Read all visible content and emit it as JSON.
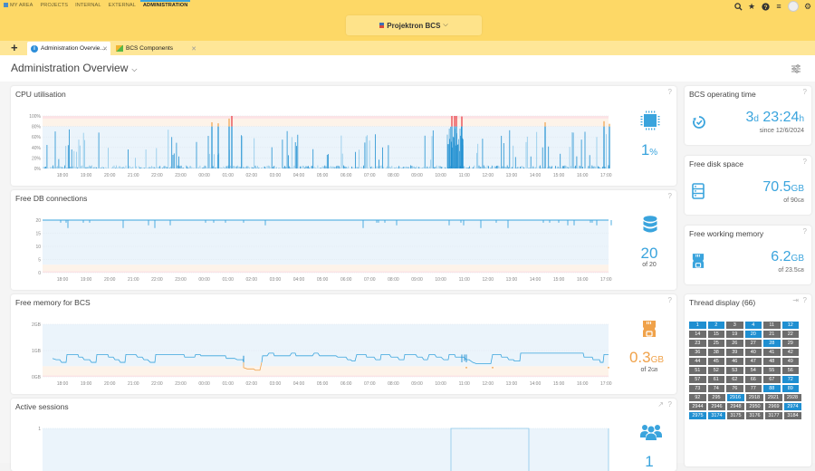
{
  "topnav": {
    "items": [
      "MY AREA",
      "PROJECTS",
      "INTERNAL",
      "EXTERNAL",
      "ADMINISTRATION"
    ],
    "active": "ADMINISTRATION",
    "icons": [
      "search-icon",
      "star-icon",
      "help-icon",
      "menu-icon",
      "avatar",
      "gear-icon"
    ]
  },
  "project_selector": {
    "label": "Projektron BCS"
  },
  "tabs": [
    {
      "label": "Administration Overvie…",
      "icon": "info-icon",
      "active": true
    },
    {
      "label": "BCS Components",
      "icon": "components-icon",
      "active": false
    }
  ],
  "page": {
    "title": "Administration Overview"
  },
  "x_ticks": [
    "18:00",
    "19:00",
    "20:00",
    "21:00",
    "22:00",
    "23:00",
    "00:00",
    "01:00",
    "02:00",
    "03:00",
    "04:00",
    "05:00",
    "06:00",
    "07:00",
    "08:00",
    "09:00",
    "10:00",
    "11:00",
    "12:00",
    "13:00",
    "14:00",
    "15:00",
    "16:00",
    "17:00"
  ],
  "cards": {
    "cpu": {
      "title": "CPU utilisation",
      "value": "1",
      "unit": "%",
      "help": "?"
    },
    "db": {
      "title": "Free DB connections",
      "value": "20",
      "sub": "of 20",
      "help": "?"
    },
    "mem": {
      "title": "Free memory for BCS",
      "value": "0.3",
      "unit": "GB",
      "sub": "of 2",
      "sub_unit": "GB",
      "help": "?"
    },
    "sessions": {
      "title": "Active sessions",
      "value": "1",
      "help": "?"
    },
    "optime": {
      "title": "BCS operating time",
      "days": "3",
      "d_unit": "d",
      "time": "23:24",
      "h_unit": "h",
      "sub": "since 12/6/2024",
      "help": "?"
    },
    "disk": {
      "title": "Free disk space",
      "value": "70.5",
      "unit": "GB",
      "sub": "of 90",
      "sub_unit": "GB",
      "help": "?"
    },
    "workmem": {
      "title": "Free working memory",
      "value": "6.2",
      "unit": "GB",
      "sub": "of 23.5",
      "sub_unit": "GB",
      "help": "?"
    },
    "threads": {
      "title": "Thread display (66)",
      "help": "?",
      "items": [
        {
          "id": "1",
          "a": true
        },
        {
          "id": "2",
          "a": true
        },
        {
          "id": "3",
          "a": false
        },
        {
          "id": "4",
          "a": true
        },
        {
          "id": "11",
          "a": false
        },
        {
          "id": "12",
          "a": true
        },
        {
          "id": "14",
          "a": false
        },
        {
          "id": "15",
          "a": false
        },
        {
          "id": "19",
          "a": false
        },
        {
          "id": "20",
          "a": true
        },
        {
          "id": "21",
          "a": false
        },
        {
          "id": "22",
          "a": false
        },
        {
          "id": "23",
          "a": false
        },
        {
          "id": "25",
          "a": false
        },
        {
          "id": "26",
          "a": false
        },
        {
          "id": "27",
          "a": false
        },
        {
          "id": "28",
          "a": true
        },
        {
          "id": "29",
          "a": false
        },
        {
          "id": "36",
          "a": false
        },
        {
          "id": "38",
          "a": false
        },
        {
          "id": "39",
          "a": false
        },
        {
          "id": "40",
          "a": false
        },
        {
          "id": "41",
          "a": false
        },
        {
          "id": "42",
          "a": false
        },
        {
          "id": "44",
          "a": false
        },
        {
          "id": "45",
          "a": false
        },
        {
          "id": "46",
          "a": false
        },
        {
          "id": "47",
          "a": false
        },
        {
          "id": "48",
          "a": false
        },
        {
          "id": "49",
          "a": false
        },
        {
          "id": "51",
          "a": false
        },
        {
          "id": "52",
          "a": false
        },
        {
          "id": "53",
          "a": false
        },
        {
          "id": "54",
          "a": false
        },
        {
          "id": "55",
          "a": false
        },
        {
          "id": "56",
          "a": false
        },
        {
          "id": "57",
          "a": false
        },
        {
          "id": "61",
          "a": false
        },
        {
          "id": "62",
          "a": false
        },
        {
          "id": "66",
          "a": false
        },
        {
          "id": "67",
          "a": false
        },
        {
          "id": "72",
          "a": true
        },
        {
          "id": "73",
          "a": false
        },
        {
          "id": "74",
          "a": false
        },
        {
          "id": "76",
          "a": false
        },
        {
          "id": "77",
          "a": false
        },
        {
          "id": "88",
          "a": true
        },
        {
          "id": "89",
          "a": true
        },
        {
          "id": "92",
          "a": false
        },
        {
          "id": "295",
          "a": false
        },
        {
          "id": "2916",
          "a": true
        },
        {
          "id": "2918",
          "a": false
        },
        {
          "id": "2921",
          "a": false
        },
        {
          "id": "2928",
          "a": false
        },
        {
          "id": "2944",
          "a": false
        },
        {
          "id": "2946",
          "a": false
        },
        {
          "id": "2948",
          "a": false
        },
        {
          "id": "2950",
          "a": false
        },
        {
          "id": "2969",
          "a": false
        },
        {
          "id": "2974",
          "a": true
        },
        {
          "id": "2975",
          "a": true
        },
        {
          "id": "3174",
          "a": true
        },
        {
          "id": "3175",
          "a": false
        },
        {
          "id": "3176",
          "a": false
        },
        {
          "id": "3177",
          "a": false
        },
        {
          "id": "3184",
          "a": false
        }
      ]
    }
  },
  "colors": {
    "accent": "#3aa4dd",
    "warn": "#f0a24a",
    "critical": "#e8343c",
    "topbar": "#fdd866",
    "thread_active": "#1f8fd1",
    "thread_idle": "#6d6d6d"
  },
  "chart_data": [
    {
      "type": "bar",
      "title": "CPU utilisation",
      "yticks": [
        "0%",
        "20%",
        "40%",
        "60%",
        "80%",
        "100%"
      ],
      "ylim": [
        0,
        100
      ],
      "x_range": [
        "17:15",
        "17:05"
      ],
      "warn_from": 80,
      "crit_from": 95,
      "current": 1
    },
    {
      "type": "line",
      "title": "Free DB connections",
      "yticks": [
        "0",
        "5",
        "10",
        "15",
        "20"
      ],
      "ylim": [
        0,
        20
      ],
      "baseline": 20,
      "min_dips": 17,
      "current": 20
    },
    {
      "type": "line",
      "title": "Free memory for BCS",
      "yticks": [
        "0GB",
        "1GB",
        "2GB"
      ],
      "ylim": [
        0,
        2
      ],
      "typical_range": [
        0.5,
        0.9
      ],
      "low_period": [
        "01:15",
        "02:00"
      ],
      "low_value": 0.2,
      "current": 0.3
    },
    {
      "type": "line",
      "title": "Active sessions",
      "yticks": [
        "1"
      ],
      "ylim": [
        0,
        1
      ],
      "current": 1
    }
  ]
}
